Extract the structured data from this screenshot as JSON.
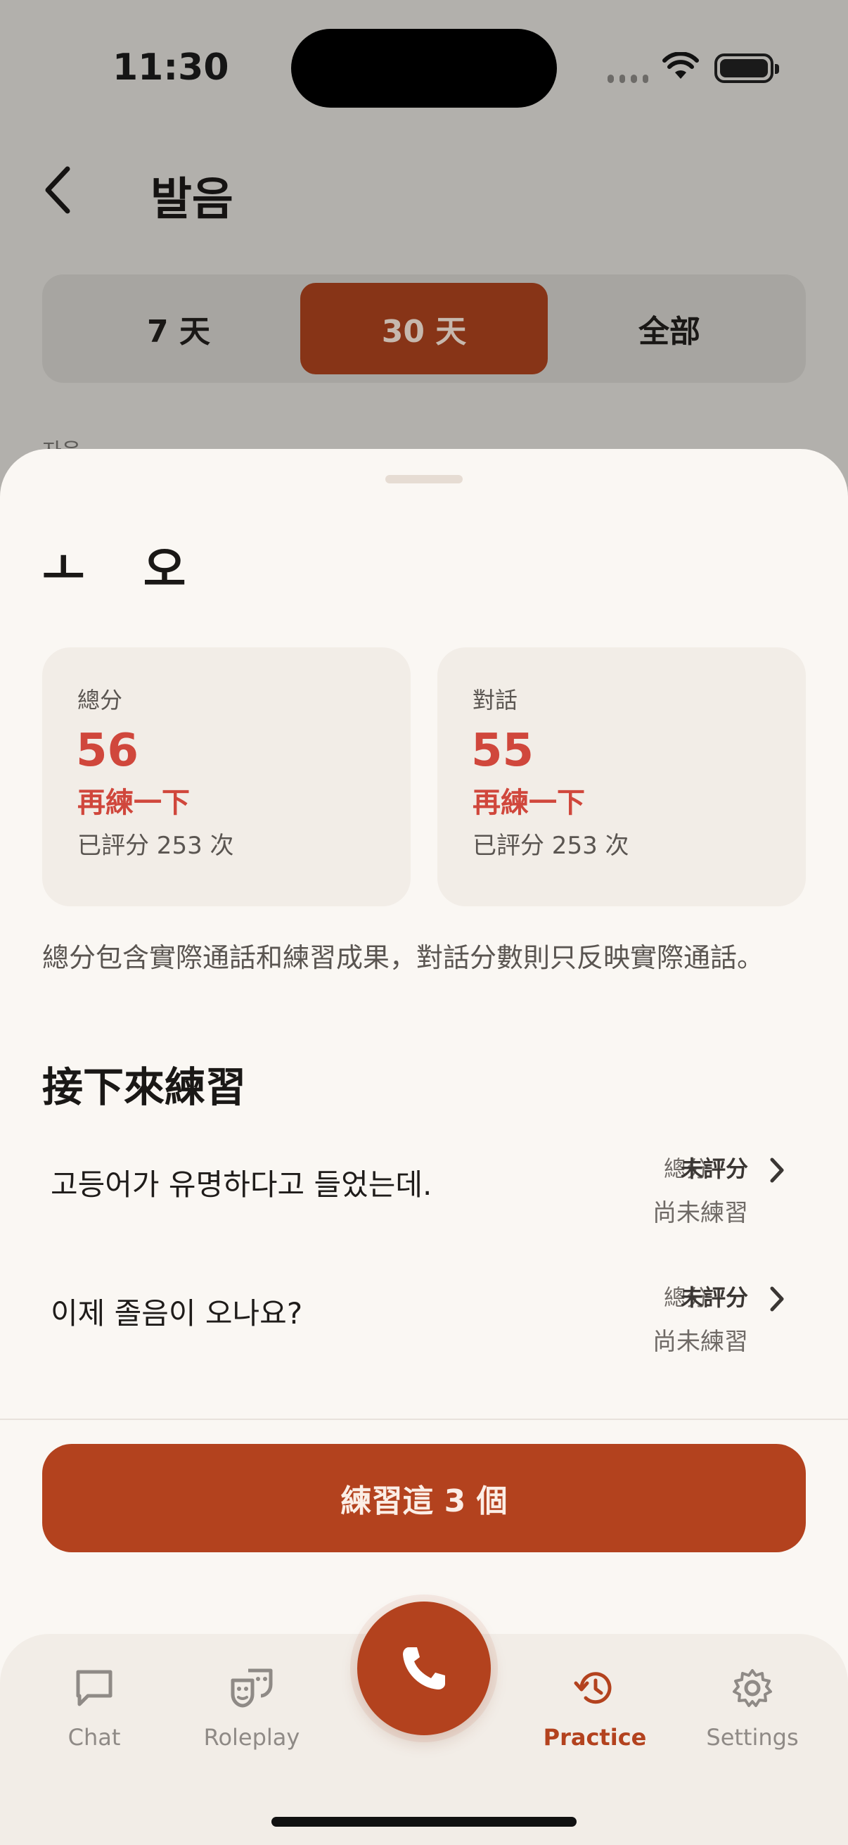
{
  "status_bar": {
    "time": "11:30"
  },
  "header": {
    "title": "발음"
  },
  "segments": {
    "items": [
      {
        "label": "7 天"
      },
      {
        "label": "30 天"
      },
      {
        "label": "全部"
      }
    ],
    "selected": "30 天"
  },
  "background": {
    "section_label": "자음"
  },
  "sheet": {
    "title": "ㅗ 오",
    "cards": [
      {
        "label": "總分",
        "score": "56",
        "status": "再練一下",
        "count": "已評分 253 次"
      },
      {
        "label": "對話",
        "score": "55",
        "status": "再練一下",
        "count": "已評分 253 次"
      }
    ],
    "note": "總分包含實際通話和練習成果，對話分數則只反映實際通話。",
    "next_title": "接下來練習",
    "rows": [
      {
        "text": "고등어가 유명하다고 들었는데.",
        "meta_label": "總分",
        "meta_value": "未評分",
        "meta_sub": "尚未練習"
      },
      {
        "text": "이제 졸음이 오나요?",
        "meta_label": "總分",
        "meta_value": "未評分",
        "meta_sub": "尚未練習"
      }
    ],
    "cta": "練習這 3 個"
  },
  "tabbar": {
    "items": [
      {
        "label": "Chat",
        "icon": "chat-icon"
      },
      {
        "label": "Roleplay",
        "icon": "masks-icon"
      },
      {
        "label": "Practice",
        "icon": "history-icon",
        "active": true
      },
      {
        "label": "Settings",
        "icon": "gear-icon"
      }
    ],
    "call_icon": "phone-icon"
  },
  "colors": {
    "accent": "#b3421e",
    "score_red": "#d0473c",
    "sheet_bg": "#faf7f3"
  }
}
